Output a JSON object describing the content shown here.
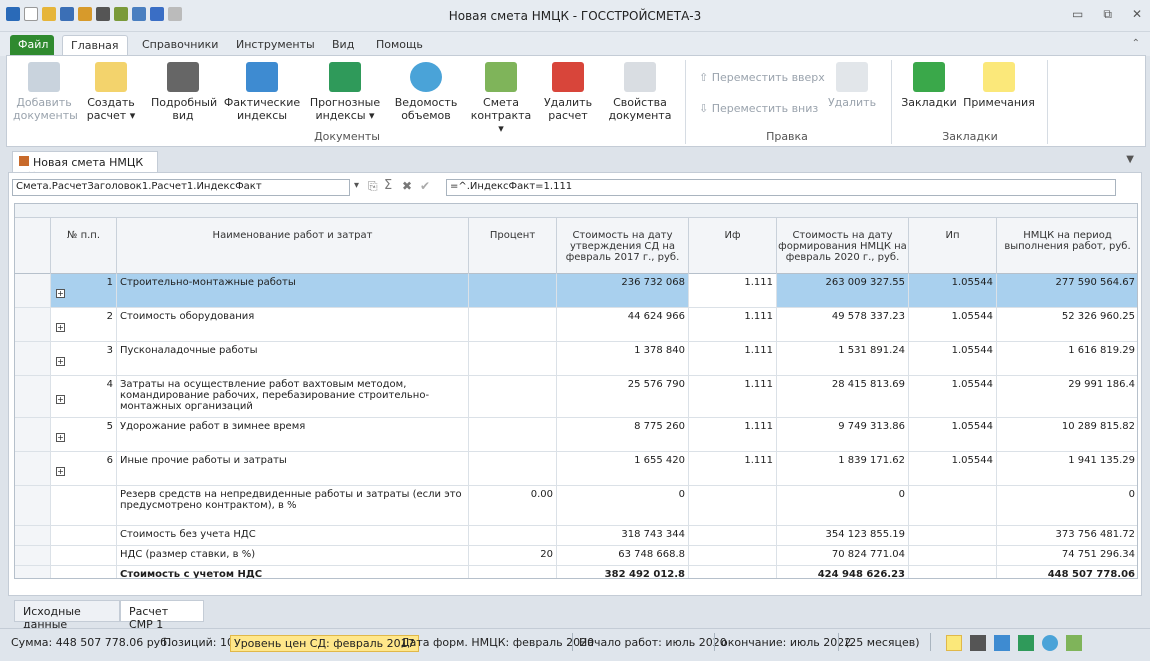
{
  "window": {
    "title": "Новая смета НМЦК - ГОССТРОЙСМЕТА-3"
  },
  "tabs": [
    "Файл",
    "Главная",
    "Справочники",
    "Инструменты",
    "Вид",
    "Помощь"
  ],
  "ribbon": {
    "buttons": [
      {
        "label": "Добавить документы",
        "icon": "add-docs"
      },
      {
        "label": "Создать расчет ▾",
        "icon": "create-calc"
      },
      {
        "label": "Подробный вид",
        "icon": "detail-view"
      },
      {
        "label": "Фактические индексы",
        "icon": "fact-indexes"
      },
      {
        "label": "Прогнозные индексы ▾",
        "icon": "forecast-indexes"
      },
      {
        "label": "Ведомость объемов",
        "icon": "volumes"
      },
      {
        "label": "Смета контракта ▾",
        "icon": "contract-estimate"
      },
      {
        "label": "Удалить расчет",
        "icon": "delete-calc"
      },
      {
        "label": "Свойства документа",
        "icon": "doc-properties"
      }
    ],
    "move_up": "Переместить вверх",
    "move_down": "Переместить вниз",
    "delete": "Удалить",
    "bookmarks": "Закладки",
    "notes": "Примечания",
    "groups": [
      "Документы",
      "Правка",
      "Закладки"
    ]
  },
  "doc_tab": "Новая смета НМЦК",
  "formula": {
    "cell": "Смета.РасчетЗаголовок1.Расчет1.ИндексФакт",
    "expr": "=^.ИндексФакт=1.111"
  },
  "columns": [
    "№ п.п.",
    "Наименование работ и затрат",
    "Процент",
    "Стоимость на дату утверждения СД на февраль 2017 г., руб.",
    "Иф",
    "Стоимость на дату формирования НМЦК на февраль 2020 г., руб.",
    "Ип",
    "НМЦК на период выполнения работ, руб."
  ],
  "rows": [
    {
      "n": "1",
      "name": "Строительно-монтажные работы",
      "pct": "",
      "c1": "236 732 068",
      "if": "1.111",
      "c2": "263 009 327.55",
      "ip": "1.05544",
      "c3": "277 590 564.67"
    },
    {
      "n": "2",
      "name": "Стоимость оборудования",
      "pct": "",
      "c1": "44 624 966",
      "if": "1.111",
      "c2": "49 578 337.23",
      "ip": "1.05544",
      "c3": "52 326 960.25"
    },
    {
      "n": "3",
      "name": "Пусконаладочные работы",
      "pct": "",
      "c1": "1 378 840",
      "if": "1.111",
      "c2": "1 531 891.24",
      "ip": "1.05544",
      "c3": "1 616 819.29"
    },
    {
      "n": "4",
      "name": "Затраты на осуществление работ вахтовым методом, командирование рабочих, перебазирование строительно-монтажных организаций",
      "pct": "",
      "c1": "25 576 790",
      "if": "1.111",
      "c2": "28 415 813.69",
      "ip": "1.05544",
      "c3": "29 991 186.4"
    },
    {
      "n": "5",
      "name": "Удорожание работ в зимнее время",
      "pct": "",
      "c1": "8 775 260",
      "if": "1.111",
      "c2": "9 749 313.86",
      "ip": "1.05544",
      "c3": "10 289 815.82"
    },
    {
      "n": "6",
      "name": "Иные прочие работы и затраты",
      "pct": "",
      "c1": "1 655 420",
      "if": "1.111",
      "c2": "1 839 171.62",
      "ip": "1.05544",
      "c3": "1 941 135.29"
    }
  ],
  "extra": [
    {
      "name": "Резерв средств на непредвиденные работы и затраты (если это предусмотрено контрактом), в %",
      "pct": "0.00",
      "c1": "0",
      "c2": "0",
      "c3": "0"
    },
    {
      "name": "Стоимость без учета НДС",
      "pct": "",
      "c1": "318 743 344",
      "c2": "354 123 855.19",
      "c3": "373 756 481.72"
    },
    {
      "name": "НДС (размер ставки, в %)",
      "pct": "20",
      "c1": "63 748 668.8",
      "c2": "70 824 771.04",
      "c3": "74 751 296.34"
    },
    {
      "name": "Стоимость с учетом НДС",
      "pct": "",
      "c1": "382 492 012.8",
      "c2": "424 948 626.23",
      "c3": "448 507 778.06"
    }
  ],
  "sheets": [
    "Исходные данные",
    "Расчет СМР 1"
  ],
  "status": {
    "sum": "Сумма: 448 507 778.06 руб.",
    "positions": "Позиций:  10",
    "price_level": "Уровень цен СД: февраль 2017",
    "form_date": "Дата форм. НМЦК: февраль 2020",
    "start": "Начало работ: июль 2020",
    "end": "окончание: июль 2022",
    "months": "(25 месяцев)"
  }
}
